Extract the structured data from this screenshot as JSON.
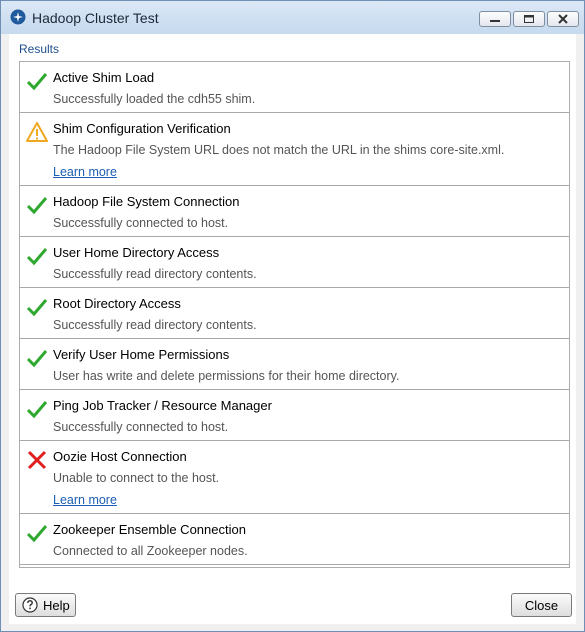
{
  "window": {
    "title": "Hadoop Cluster Test"
  },
  "results_label": "Results",
  "results": [
    {
      "title": "Active Shim Load",
      "message": "Successfully loaded the cdh55 shim.",
      "status": "success",
      "icon": "check-icon"
    },
    {
      "title": "Shim Configuration Verification",
      "message": "The Hadoop File System URL does not match the URL in the shims core-site.xml.",
      "link": "Learn more",
      "status": "warning",
      "icon": "warning-icon"
    },
    {
      "title": "Hadoop File System Connection",
      "message": "Successfully connected to host.",
      "status": "success",
      "icon": "check-icon"
    },
    {
      "title": "User Home Directory Access",
      "message": "Successfully read directory contents.",
      "status": "success",
      "icon": "check-icon"
    },
    {
      "title": "Root Directory Access",
      "message": "Successfully read directory contents.",
      "status": "success",
      "icon": "check-icon"
    },
    {
      "title": "Verify User Home Permissions",
      "message": "User has write and delete permissions for their home directory.",
      "status": "success",
      "icon": "check-icon"
    },
    {
      "title": "Ping Job Tracker / Resource Manager",
      "message": "Successfully connected to host.",
      "status": "success",
      "icon": "check-icon"
    },
    {
      "title": "Oozie Host Connection",
      "message": "Unable to connect to the host.",
      "link": "Learn more",
      "status": "error",
      "icon": "error-x-icon"
    },
    {
      "title": "Zookeeper Ensemble Connection",
      "message": "Connected to all Zookeeper nodes.",
      "status": "success",
      "icon": "check-icon"
    }
  ],
  "buttons": {
    "help": "Help",
    "close": "Close"
  },
  "colors": {
    "success": "#2ea82e",
    "warning": "#f0a81e",
    "error": "#e02020",
    "link": "#1a5fb4"
  }
}
